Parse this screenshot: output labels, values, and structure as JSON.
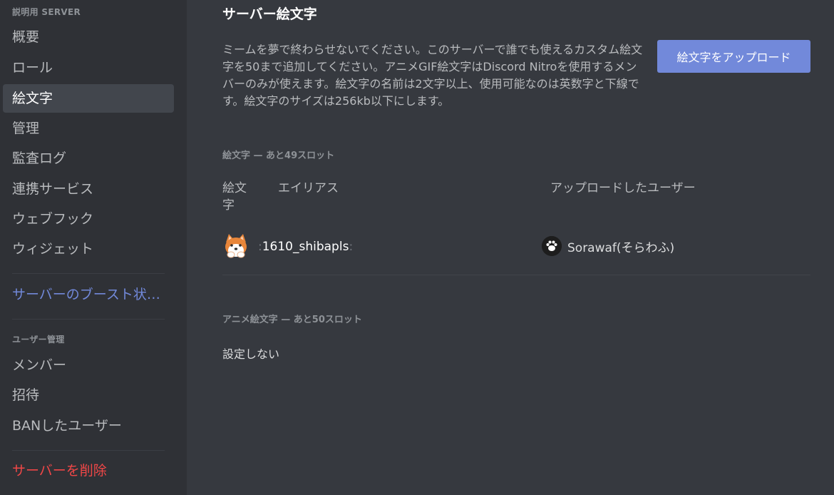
{
  "sidebar": {
    "server_header": "説明用 SERVER",
    "items": [
      {
        "label": "概要"
      },
      {
        "label": "ロール"
      },
      {
        "label": "絵文字"
      },
      {
        "label": "管理"
      },
      {
        "label": "監査ログ"
      },
      {
        "label": "連携サービス"
      },
      {
        "label": "ウェブフック"
      },
      {
        "label": "ウィジェット"
      }
    ],
    "boost_label": "サーバーのブースト状…",
    "user_mgmt_header": "ユーザー管理",
    "user_items": [
      {
        "label": "メンバー"
      },
      {
        "label": "招待"
      },
      {
        "label": "BANしたユーザー"
      }
    ],
    "delete_label": "サーバーを削除",
    "selected_index": 2
  },
  "main": {
    "title": "サーバー絵文字",
    "description": "ミームを夢で終わらせないでください。このサーバーで誰でも使えるカスタム絵文字を50まで追加してください。アニメGIF絵文字はDiscord Nitroを使用するメンバーのみが使えます。絵文字の名前は2文字以上、使用可能なのは英数字と下線です。絵文字のサイズは256kb以下にします。",
    "upload_button": "絵文字をアップロード",
    "static_section": "絵文字 — あと49スロット",
    "columns": {
      "emoji": "絵文字",
      "alias": "エイリアス",
      "uploader": "アップロードしたユーザー"
    },
    "emojis": [
      {
        "icon": "shiba-dog-icon",
        "colon_left": ":",
        "alias": "1610_shibapls",
        "colon_right": ":",
        "uploader": "Sorawaf(そらわふ)"
      }
    ],
    "animated_section": "アニメ絵文字 — あと50スロット",
    "animated_empty": "設定しない"
  },
  "colors": {
    "accent": "#7289da",
    "danger": "#f04747",
    "sidebar_bg": "#2f3136",
    "main_bg": "#36393f"
  }
}
